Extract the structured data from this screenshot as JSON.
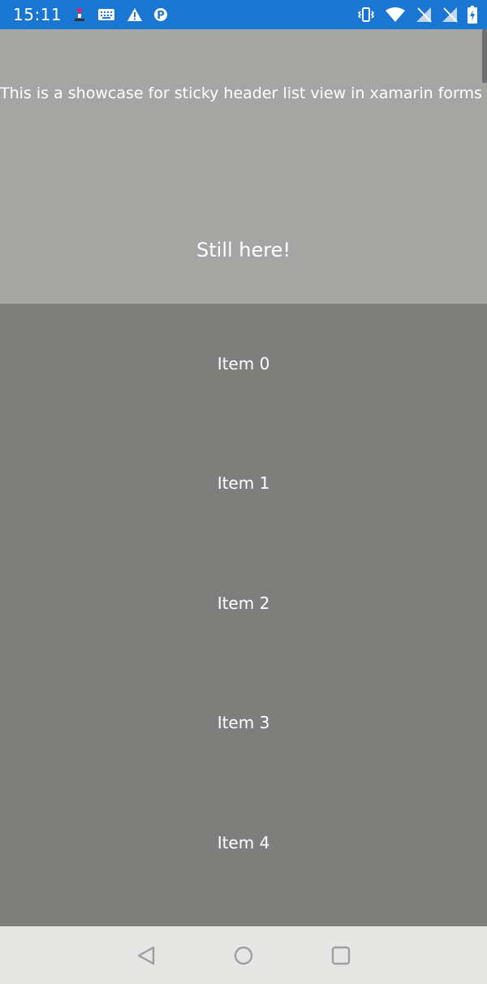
{
  "status_bar": {
    "time": "15:11",
    "left_icons": [
      "usb-debug-icon",
      "keyboard-icon",
      "warning-icon",
      "parking-icon"
    ],
    "right_icons": [
      "vibrate-icon",
      "wifi-icon",
      "no-signal-icon",
      "no-signal-icon",
      "battery-charging-icon"
    ],
    "background": "#1976d2"
  },
  "header": {
    "description": "This is a showcase for sticky header list view in xamarin forms",
    "sticky_title": "Still here!",
    "background": "#a5a6a4"
  },
  "list": {
    "background": "#7e7f7d",
    "items": [
      {
        "label": "Item 0"
      },
      {
        "label": "Item 1"
      },
      {
        "label": "Item 2"
      },
      {
        "label": "Item 3"
      },
      {
        "label": "Item 4"
      }
    ]
  },
  "nav_bar": {
    "buttons": [
      "back-icon",
      "home-icon",
      "recents-icon"
    ],
    "background": "#e6e7e5"
  }
}
